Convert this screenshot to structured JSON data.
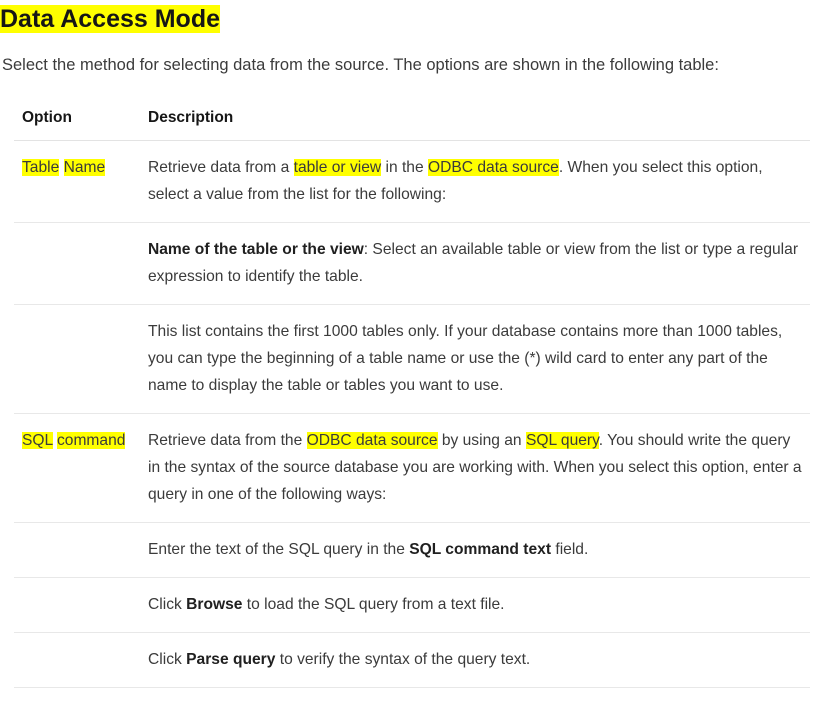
{
  "page": {
    "title": "Data Access Mode",
    "title_highlighted": true,
    "intro": "Select the method for selecting data from the source. The options are shown in the following table:"
  },
  "colors": {
    "highlight": "#ffff00",
    "body_text": "#3b3b3b",
    "heading_text": "#161616",
    "row_divider": "#e8e8e8"
  },
  "table": {
    "headers": {
      "option": "Option",
      "description": "Description"
    },
    "rows": [
      {
        "option": "Table Name",
        "option_highlighted": true,
        "description_plain": "Retrieve data from a table or view in the ODBC data source. When you select this option, select a value from the list for the following:",
        "description_segments": [
          {
            "text": "Retrieve data from a ",
            "style": "plain"
          },
          {
            "text": "table or view",
            "style": "highlight"
          },
          {
            "text": " in the ",
            "style": "plain"
          },
          {
            "text": "ODBC data source",
            "style": "highlight"
          },
          {
            "text": ". When you select this option, select a value from the list for the following:",
            "style": "plain"
          }
        ]
      },
      {
        "option": "",
        "option_highlighted": false,
        "description_plain": "Name of the table or the view: Select an available table or view from the list or type a regular expression to identify the table.",
        "description_segments": [
          {
            "text": "Name of the table or the view",
            "style": "bold"
          },
          {
            "text": ": Select an available table or view from the list or type a regular expression to identify the table.",
            "style": "plain"
          }
        ]
      },
      {
        "option": "",
        "option_highlighted": false,
        "description_plain": "This list contains the first 1000 tables only. If your database contains more than 1000 tables, you can type the beginning of a table name or use the (*) wild card to enter any part of the name to display the table or tables you want to use.",
        "description_segments": [
          {
            "text": "This list contains the first 1000 tables only. If your database contains more than 1000 tables, you can type the beginning of a table name or use the (*) wild card to enter any part of the name to display the table or tables you want to use.",
            "style": "plain"
          }
        ]
      },
      {
        "option": "SQL command",
        "option_highlighted": true,
        "description_plain": "Retrieve data from the ODBC data source by using an SQL query. You should write the query in the syntax of the source database you are working with. When you select this option, enter a query in one of the following ways:",
        "description_segments": [
          {
            "text": "Retrieve data from the ",
            "style": "plain"
          },
          {
            "text": "ODBC data source",
            "style": "highlight"
          },
          {
            "text": " by using an ",
            "style": "plain"
          },
          {
            "text": "SQL query",
            "style": "highlight"
          },
          {
            "text": ". You should write the query in the syntax of the source database you are working with. When you select this option, enter a query in one of the following ways:",
            "style": "plain"
          }
        ]
      },
      {
        "option": "",
        "option_highlighted": false,
        "description_plain": "Enter the text of the SQL query in the SQL command text field.",
        "description_segments": [
          {
            "text": "Enter the text of the SQL query in the ",
            "style": "plain"
          },
          {
            "text": "SQL command text",
            "style": "bold"
          },
          {
            "text": " field.",
            "style": "plain"
          }
        ]
      },
      {
        "option": "",
        "option_highlighted": false,
        "description_plain": "Click Browse to load the SQL query from a text file.",
        "description_segments": [
          {
            "text": "Click ",
            "style": "plain"
          },
          {
            "text": "Browse",
            "style": "bold"
          },
          {
            "text": " to load the SQL query from a text file.",
            "style": "plain"
          }
        ]
      },
      {
        "option": "",
        "option_highlighted": false,
        "description_plain": "Click Parse query to verify the syntax of the query text.",
        "description_segments": [
          {
            "text": "Click ",
            "style": "plain"
          },
          {
            "text": "Parse query",
            "style": "bold"
          },
          {
            "text": " to verify the syntax of the query text.",
            "style": "plain"
          }
        ]
      }
    ]
  }
}
